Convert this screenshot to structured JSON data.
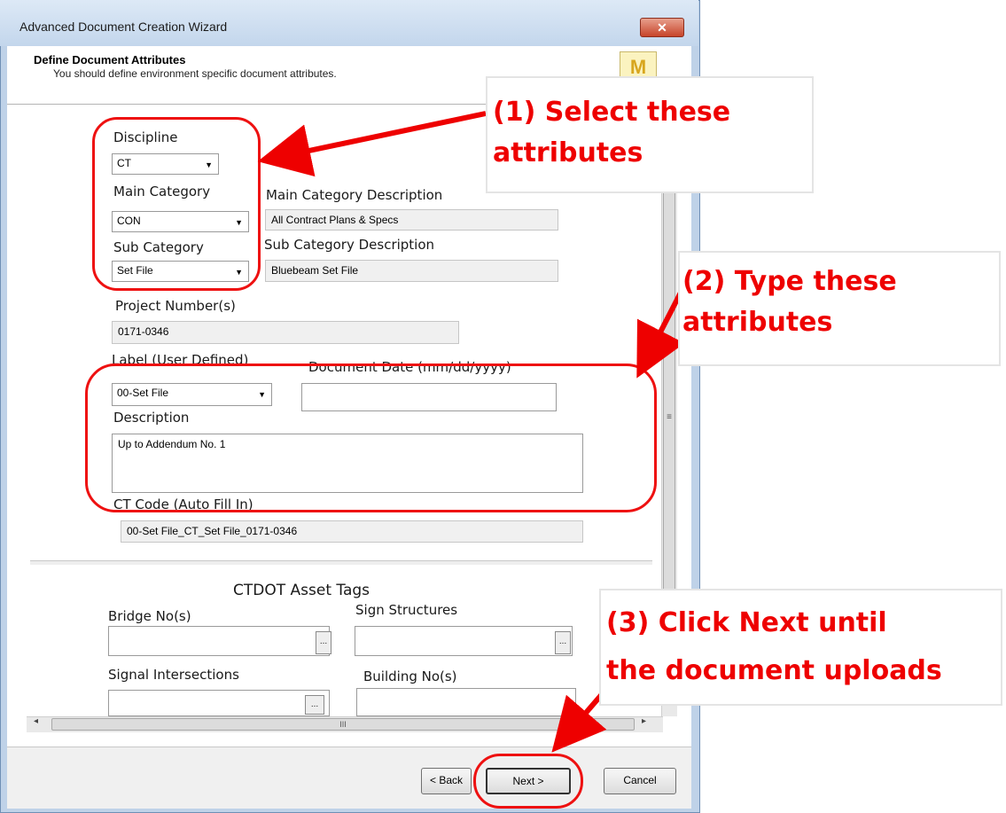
{
  "window": {
    "title": "Advanced Document Creation Wizard",
    "close_glyph": "✕"
  },
  "header": {
    "title": "Define Document Attributes",
    "subtitle": "You should define environment specific document attributes.",
    "icon": "wizard-icon"
  },
  "form": {
    "discipline": {
      "label": "Discipline",
      "value": "CT"
    },
    "main_category": {
      "label": "Main Category",
      "value": "CON"
    },
    "main_category_description": {
      "label": "Main Category Description",
      "value": "All Contract Plans & Specs"
    },
    "sub_category": {
      "label": "Sub Category",
      "value": "Set File"
    },
    "sub_category_description": {
      "label": "Sub Category Description",
      "value": "Bluebeam Set File"
    },
    "project_numbers": {
      "label": "Project Number(s)",
      "value": "0171-0346"
    },
    "label_user_defined": {
      "label": "Label (User Defined)",
      "value": "00-Set File"
    },
    "document_date": {
      "label": "Document Date (mm/dd/yyyy)",
      "value": ""
    },
    "description": {
      "label": "Description",
      "value": "Up to Addendum No. 1"
    },
    "ct_code": {
      "label": "CT Code (Auto Fill In)",
      "value": "00-Set File_CT_Set File_0171-0346"
    }
  },
  "asset_tags": {
    "heading": "CTDOT Asset Tags",
    "bridge": {
      "label": "Bridge No(s)",
      "button": "..."
    },
    "sign_structures": {
      "label": "Sign Structures",
      "button": "..."
    },
    "signal_intersections": {
      "label": "Signal Intersections",
      "button": "..."
    },
    "building": {
      "label": "Building No(s)"
    }
  },
  "scrollbars": {
    "v_grip": "≡",
    "h_grip": "III",
    "left": "◂",
    "right": "▸"
  },
  "buttons": {
    "back": "< Back",
    "next": "Next >",
    "cancel": "Cancel"
  },
  "annotations": {
    "step1": [
      "(1) Select these",
      "attributes"
    ],
    "step2": [
      "(2) Type these",
      "attributes"
    ],
    "step3": [
      "(3) Click Next until",
      "the document uploads"
    ],
    "color": "#ee0000"
  }
}
